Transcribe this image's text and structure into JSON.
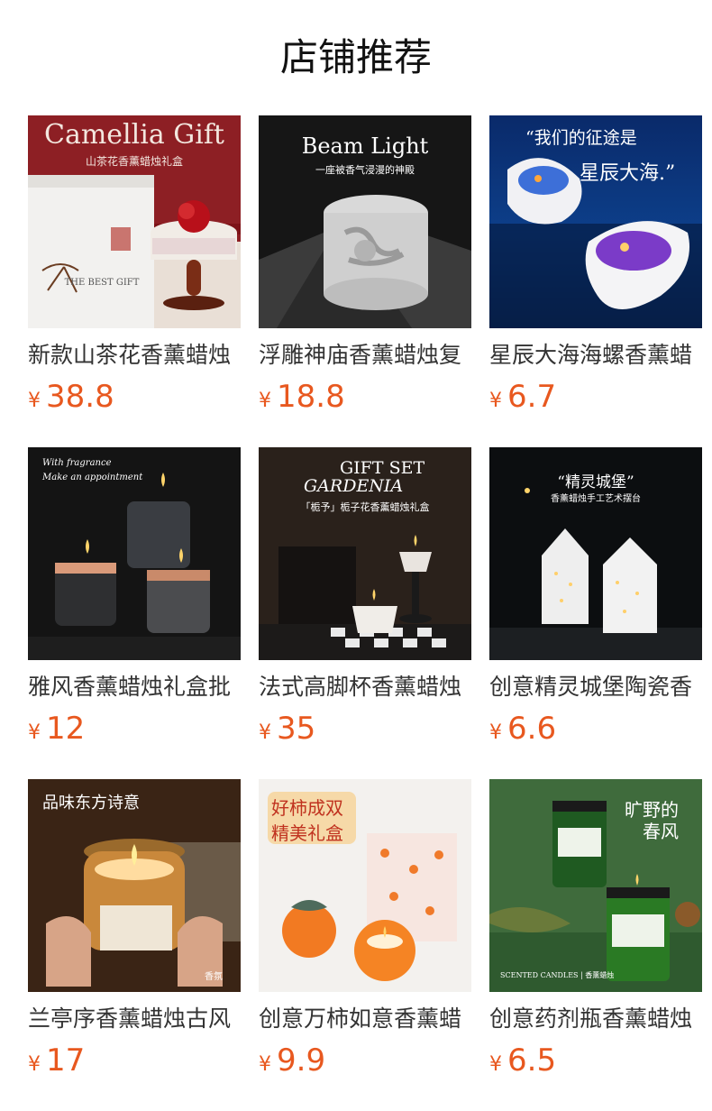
{
  "section_title": "店铺推荐",
  "currency_symbol": "¥",
  "products": [
    {
      "name": "新款山茶花香薰蜡烛",
      "price": "38.8",
      "img_text": [
        "Camellia Gift",
        "山茶花香薰蜡烛礼盒",
        "THE BEST GIFT"
      ]
    },
    {
      "name": "浮雕神庙香薰蜡烛复",
      "price": "18.8",
      "img_text": [
        "Beam Light",
        "一座被香气浸漫的神殿"
      ]
    },
    {
      "name": "星辰大海海螺香薰蜡",
      "price": "6.7",
      "img_text": [
        "“我们的征途是",
        "星辰大海.”"
      ]
    },
    {
      "name": "雅风香薰蜡烛礼盒批",
      "price": "12",
      "img_text": [
        "With fragrance",
        "Make an appointment"
      ]
    },
    {
      "name": "法式高脚杯香薰蜡烛",
      "price": "35",
      "img_text": [
        "GIFT SET",
        "GARDENIA",
        "「栀予」栀子花香薰蜡烛礼盒"
      ]
    },
    {
      "name": "创意精灵城堡陶瓷香",
      "price": "6.6",
      "img_text": [
        "“精灵城堡”",
        "香薰蜡烛手工艺术摆台"
      ]
    },
    {
      "name": "兰亭序香薰蜡烛古风",
      "price": "17",
      "img_text": [
        "品味东方诗意",
        "香氛"
      ]
    },
    {
      "name": "创意万柿如意香薰蜡",
      "price": "9.9",
      "img_text": [
        "好柿成双",
        "精美礼盒"
      ]
    },
    {
      "name": "创意药剂瓶香薰蜡烛",
      "price": "6.5",
      "img_text": [
        "旷野的",
        "春风",
        "SCENTED CANDLES | 香薰蜡烛"
      ]
    }
  ],
  "colors": {
    "price": "#e8581f",
    "title": "#111111",
    "name": "#333333"
  }
}
